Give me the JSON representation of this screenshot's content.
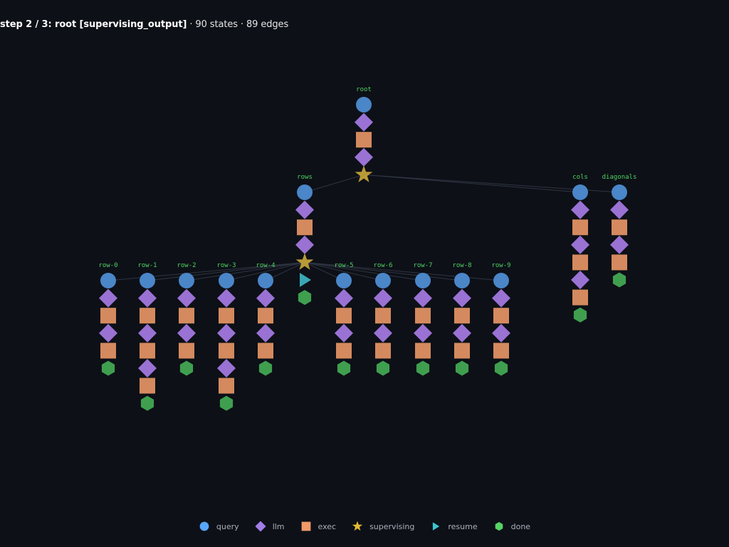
{
  "header": {
    "step_label": "step 2 / 3: root [supervising_output]",
    "stats": " · 90 states · 89 edges"
  },
  "colors": {
    "background": "#0d1017",
    "query": "#4a86c8",
    "llm": "#9a72d4",
    "exec": "#d48a5e",
    "supervising": "#b89a36",
    "resume": "#3aa6b4",
    "done": "#3f9f4f",
    "label": "#4fd062",
    "edge": "#2f3542"
  },
  "legend": [
    {
      "name": "query",
      "icon": "circle",
      "color": "#58a6ff"
    },
    {
      "name": "llm",
      "icon": "diamond",
      "color": "#a17ee5"
    },
    {
      "name": "exec",
      "icon": "square",
      "color": "#ef9a68"
    },
    {
      "name": "supervising",
      "icon": "star",
      "color": "#e3bb33"
    },
    {
      "name": "resume",
      "icon": "triangle",
      "color": "#39c5cf"
    },
    {
      "name": "done",
      "icon": "hexagon",
      "color": "#56d364"
    }
  ],
  "nodes": [
    {
      "label": "root",
      "sequence": [
        "query",
        "llm",
        "exec",
        "llm",
        "supervising"
      ]
    },
    {
      "label": "rows",
      "sequence": [
        "query",
        "llm",
        "exec",
        "llm",
        "supervising",
        "resume",
        "done"
      ]
    },
    {
      "label": "cols",
      "sequence": [
        "query",
        "llm",
        "exec",
        "llm",
        "exec",
        "llm",
        "exec",
        "done"
      ]
    },
    {
      "label": "diagonals",
      "sequence": [
        "query",
        "llm",
        "exec",
        "llm",
        "exec",
        "done"
      ]
    },
    {
      "label": "row-0",
      "sequence": [
        "query",
        "llm",
        "exec",
        "llm",
        "exec",
        "done"
      ]
    },
    {
      "label": "row-1",
      "sequence": [
        "query",
        "llm",
        "exec",
        "llm",
        "exec",
        "llm",
        "exec",
        "done"
      ]
    },
    {
      "label": "row-2",
      "sequence": [
        "query",
        "llm",
        "exec",
        "llm",
        "exec",
        "done"
      ]
    },
    {
      "label": "row-3",
      "sequence": [
        "query",
        "llm",
        "exec",
        "llm",
        "exec",
        "llm",
        "exec",
        "done"
      ]
    },
    {
      "label": "row-4",
      "sequence": [
        "query",
        "llm",
        "exec",
        "llm",
        "exec",
        "done"
      ]
    },
    {
      "label": "row-5",
      "sequence": [
        "query",
        "llm",
        "exec",
        "llm",
        "exec",
        "done"
      ]
    },
    {
      "label": "row-6",
      "sequence": [
        "query",
        "llm",
        "exec",
        "llm",
        "exec",
        "done"
      ]
    },
    {
      "label": "row-7",
      "sequence": [
        "query",
        "llm",
        "exec",
        "llm",
        "exec",
        "done"
      ]
    },
    {
      "label": "row-8",
      "sequence": [
        "query",
        "llm",
        "exec",
        "llm",
        "exec",
        "done"
      ]
    },
    {
      "label": "row-9",
      "sequence": [
        "query",
        "llm",
        "exec",
        "llm",
        "exec",
        "done"
      ]
    }
  ],
  "edges": [
    {
      "from": "root",
      "to": "rows"
    },
    {
      "from": "root",
      "to": "cols"
    },
    {
      "from": "root",
      "to": "diagonals"
    },
    {
      "from": "rows",
      "to": "row-0"
    },
    {
      "from": "rows",
      "to": "row-1"
    },
    {
      "from": "rows",
      "to": "row-2"
    },
    {
      "from": "rows",
      "to": "row-3"
    },
    {
      "from": "rows",
      "to": "row-4"
    },
    {
      "from": "rows",
      "to": "row-5"
    },
    {
      "from": "rows",
      "to": "row-6"
    },
    {
      "from": "rows",
      "to": "row-7"
    },
    {
      "from": "rows",
      "to": "row-8"
    },
    {
      "from": "rows",
      "to": "row-9"
    }
  ]
}
